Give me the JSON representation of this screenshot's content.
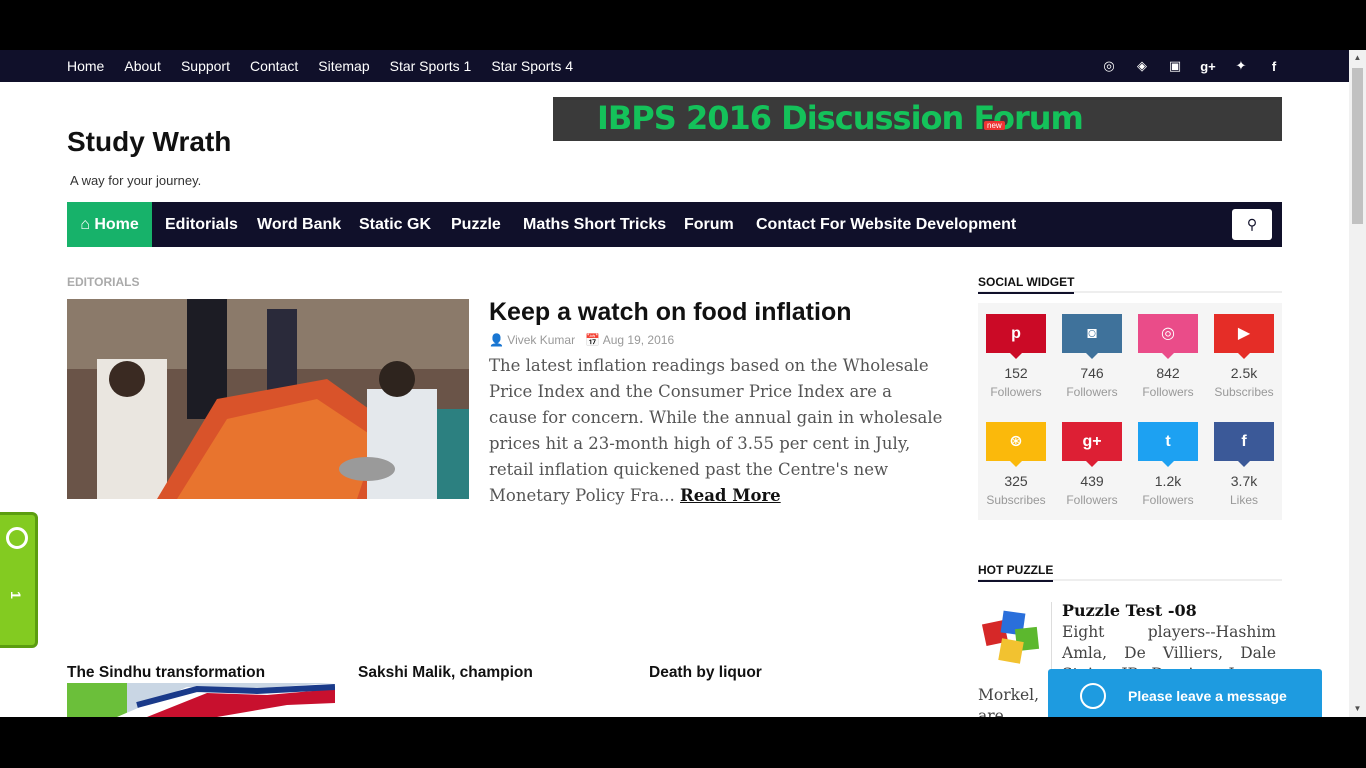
{
  "top_nav": [
    "Home",
    "About",
    "Support",
    "Contact",
    "Sitemap",
    "Star Sports 1",
    "Star Sports 4"
  ],
  "top_social_icons": [
    "dribbble-icon",
    "codepen-icon",
    "youtube-icon",
    "google-plus-icon",
    "twitter-icon",
    "facebook-icon"
  ],
  "header": {
    "logo": "Study Wrath",
    "tagline": "A way for your journey.",
    "banner_text": "IBPS 2016 Discussion Forum",
    "banner_badge": "new"
  },
  "main_nav": {
    "home": "Home",
    "items": [
      "Editorials",
      "Word Bank",
      "Static GK",
      "Puzzle",
      "Maths Short Tricks",
      "Forum",
      "Contact For Website Development"
    ]
  },
  "featured": {
    "section": "EDITORIALS",
    "title": "Keep a watch on food inflation",
    "author": "Vivek Kumar",
    "date": "Aug 19, 2016",
    "excerpt": "The latest inflation readings based on the Wholesale Price Index and the Consumer Price Index are a cause for concern. While the annual gain in wholesale prices hit a 23-month high of 3.55 per cent in July, retail inflation quickened past the Centre's new Monetary Policy Fra...",
    "read_more": "Read More"
  },
  "sub_posts": [
    "The Sindhu transformation",
    "Sakshi Malik, champion",
    "Death by liquor"
  ],
  "social_widget": {
    "title": "SOCIAL WIDGET",
    "items": [
      {
        "icon": "pinterest-icon",
        "glyph": "p",
        "count": "152",
        "label": "Followers",
        "color": "#cb0a26"
      },
      {
        "icon": "instagram-icon",
        "glyph": "◙",
        "count": "746",
        "label": "Followers",
        "color": "#3f729b"
      },
      {
        "icon": "dribbble-icon",
        "glyph": "◎",
        "count": "842",
        "label": "Followers",
        "color": "#ea4c89"
      },
      {
        "icon": "youtube-icon",
        "glyph": "▶",
        "count": "2.5k",
        "label": "Subscribes",
        "color": "#e52d27"
      },
      {
        "icon": "rss-icon",
        "glyph": "⊛",
        "count": "325",
        "label": "Subscribes",
        "color": "#fbb90b"
      },
      {
        "icon": "google-plus-icon",
        "glyph": "g+",
        "count": "439",
        "label": "Followers",
        "color": "#dd1f34"
      },
      {
        "icon": "twitter-icon",
        "glyph": "t",
        "count": "1.2k",
        "label": "Followers",
        "color": "#1da1f2"
      },
      {
        "icon": "facebook-icon",
        "glyph": "f",
        "count": "3.7k",
        "label": "Likes",
        "color": "#3b5998"
      }
    ]
  },
  "hot_puzzle": {
    "title": "HOT PUZZLE",
    "post_title": "Puzzle Test -08",
    "text": "Eight players--Hashim Amla, De Villiers, Dale Stein, JP Duminy, Imran Tahir, Morne Morkel,",
    "text2": "Morkel, are sitting"
  },
  "chat": {
    "label": "Please leave a message"
  },
  "side_tab": {
    "label": "1"
  }
}
